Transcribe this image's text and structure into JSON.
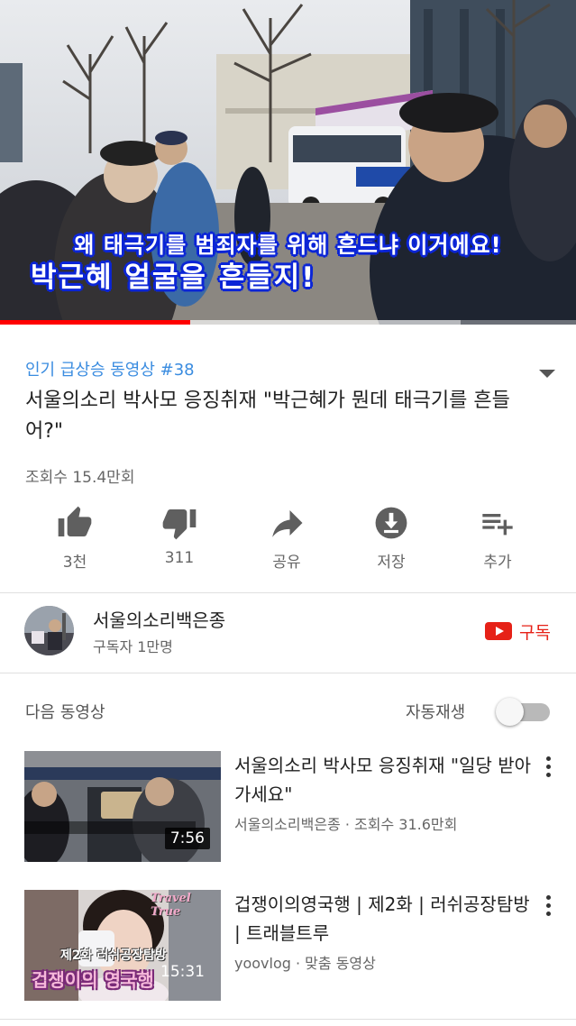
{
  "player": {
    "subtitle_line1": "왜 태극기를 범죄자를 위해 흔드냐 이거에요!",
    "subtitle_line2": "박근혜 얼굴을 흔들지!",
    "progress": 0.33,
    "buffered": 0.8,
    "accent_color": "#ff0000"
  },
  "video": {
    "trending_label": "인기 급상승 동영상 #38",
    "title": "서울의소리 박사모 응징취재 \"박근혜가 뭔데 태극기를 흔들어?\"",
    "views": "조회수 15.4만회"
  },
  "actions": [
    {
      "icon": "thumbs-up-icon",
      "label": "3천"
    },
    {
      "icon": "thumbs-down-icon",
      "label": "311"
    },
    {
      "icon": "share-icon",
      "label": "공유"
    },
    {
      "icon": "download-icon",
      "label": "저장"
    },
    {
      "icon": "add-to-playlist-icon",
      "label": "추가"
    }
  ],
  "channel": {
    "name": "서울의소리백은종",
    "subscribers": "구독자 1만명",
    "subscribe_label": "구독",
    "brand_color": "#e62117"
  },
  "up_next": {
    "heading": "다음 동영상",
    "autoplay_label": "자동재생",
    "autoplay_on": false,
    "items": [
      {
        "title": "서울의소리 박사모 응징취재 \"일당 받아 가세요\"",
        "meta": "서울의소리백은종 · 조회수 31.6만회",
        "duration": "7:56"
      },
      {
        "title": "겁쟁이의영국행 | 제2화 | 러쉬공장탐방 | 트래블트루",
        "meta": "yoovlog · 맞춤 동영상",
        "duration": "15:31",
        "thumb_text_top": "Travel True",
        "thumb_text_mid": "제2화 러쉬공장탐방",
        "thumb_text_bottom": "겁쟁이의 영국행"
      }
    ]
  }
}
